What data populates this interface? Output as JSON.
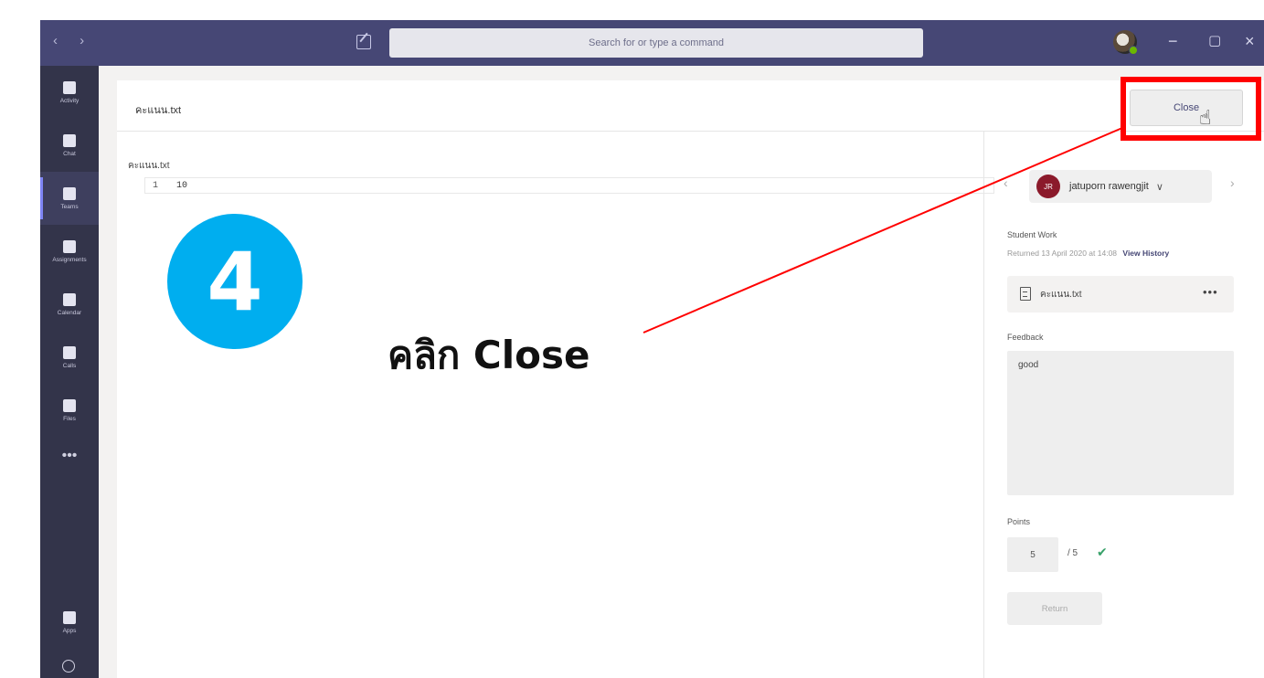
{
  "titlebar": {
    "nav_arrows": "‹ ›",
    "search_placeholder": "Search for or type a command",
    "window_buttons": {
      "minimize": "−",
      "maximize": "▢",
      "close": "×"
    }
  },
  "rail": {
    "items": [
      {
        "label": "Activity",
        "icon": "bell-icon"
      },
      {
        "label": "Chat",
        "icon": "chat-icon"
      },
      {
        "label": "Teams",
        "icon": "teams-icon",
        "active": true
      },
      {
        "label": "Assignments",
        "icon": "assignments-icon"
      },
      {
        "label": "Calendar",
        "icon": "calendar-icon"
      },
      {
        "label": "Calls",
        "icon": "phone-icon"
      },
      {
        "label": "Files",
        "icon": "files-icon"
      }
    ],
    "more": "•••",
    "bottom_items": [
      {
        "label": "Apps",
        "icon": "apps-icon"
      }
    ]
  },
  "header": {
    "file_title": "คะแนน.txt",
    "close_label": "Close"
  },
  "editor": {
    "file_label": "คะแนน.txt",
    "line_number": "1",
    "line_text": "10"
  },
  "review_panel": {
    "student_initials": "JR",
    "student_name": "jatuporn rawengjit",
    "student_work_label": "Student Work",
    "returned_text": "Returned 13 April 2020 at 14:08",
    "view_history": "View History",
    "file_name": "คะแนน.txt",
    "file_more": "•••",
    "feedback_label": "Feedback",
    "feedback_text": "good",
    "points_label": "Points",
    "points_value": "5",
    "points_total": "/ 5",
    "return_label": "Return"
  },
  "overlay": {
    "step_number": "4",
    "instruction": "คลิก Close",
    "highlight_color": "#ff0000",
    "badge_color": "#00aeef"
  },
  "colors": {
    "titlebar": "#464775",
    "rail": "#33344a",
    "accent": "#464775"
  }
}
